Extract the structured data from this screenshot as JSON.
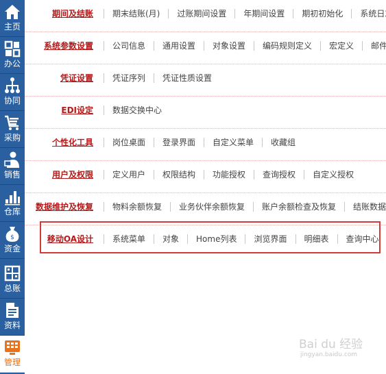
{
  "sidebar": {
    "items": [
      {
        "label": "主页",
        "icon": "home-icon"
      },
      {
        "label": "办公",
        "icon": "office-icon"
      },
      {
        "label": "协同",
        "icon": "collaboration-icon"
      },
      {
        "label": "采购",
        "icon": "cart-icon"
      },
      {
        "label": "销售",
        "icon": "salesperson-icon"
      },
      {
        "label": "仓库",
        "icon": "warehouse-icon"
      },
      {
        "label": "资金",
        "icon": "money-bag-icon"
      },
      {
        "label": "总账",
        "icon": "ledger-icon"
      },
      {
        "label": "资料",
        "icon": "documents-icon"
      },
      {
        "label": "管理",
        "icon": "management-icon",
        "active": true
      }
    ]
  },
  "rows": [
    {
      "category": "期间及结账",
      "items": [
        "期末结账(月)",
        "过账期间设置",
        "年期间设置",
        "期初初始化",
        "系统日志"
      ]
    },
    {
      "category": "系统参数设置",
      "items": [
        "公司信息",
        "通用设置",
        "对象设置",
        "编码规则定义",
        "宏定义",
        "邮件"
      ]
    },
    {
      "category": "凭证设置",
      "items": [
        "凭证序列",
        "凭证性质设置"
      ]
    },
    {
      "category": "EDI设定",
      "items": [
        "数据交换中心"
      ]
    },
    {
      "category": "个性化工具",
      "items": [
        "岗位桌面",
        "登录界面",
        "自定义菜单",
        "收藏组"
      ]
    },
    {
      "category": "用户及权限",
      "items": [
        "定义用户",
        "权限结构",
        "功能授权",
        "查询授权",
        "自定义授权"
      ]
    },
    {
      "category": "数据维护及恢复",
      "items": [
        "物料余额恢复",
        "业务伙伴余额恢复",
        "账户余额检查及恢复",
        "结账数据"
      ]
    },
    {
      "category": "移动OA设计",
      "items": [
        "系统菜单",
        "对象",
        "Home列表",
        "浏览界面",
        "明细表",
        "查询中心"
      ]
    }
  ],
  "colors": {
    "sidebar": "#2a5fa0",
    "category": "#b51a1a",
    "highlight": "#d23a3a",
    "active_label": "#e8731c"
  },
  "watermark": {
    "text": "Bai du 经验",
    "url": "jingyan.baidu.com"
  }
}
